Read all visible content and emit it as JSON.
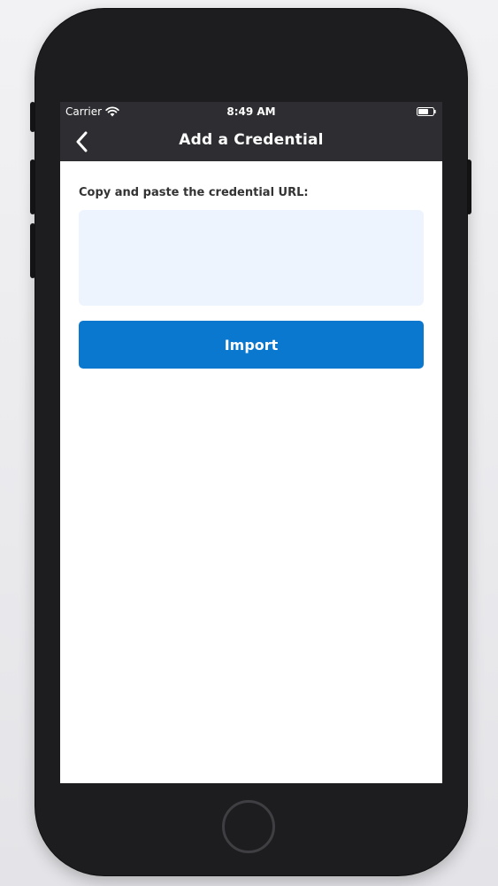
{
  "status_bar": {
    "carrier": "Carrier",
    "time": "8:49 AM"
  },
  "nav": {
    "title": "Add a Credential"
  },
  "form": {
    "label": "Copy and paste the credential URL:",
    "url_value": "",
    "import_label": "Import"
  },
  "colors": {
    "bar_background": "#2e2d31",
    "input_background": "#edf4fd",
    "accent": "#0a78cf"
  },
  "icons": {
    "wifi": "wifi-icon",
    "battery": "battery-icon",
    "back": "chevron-left-icon",
    "home": "home-button"
  }
}
